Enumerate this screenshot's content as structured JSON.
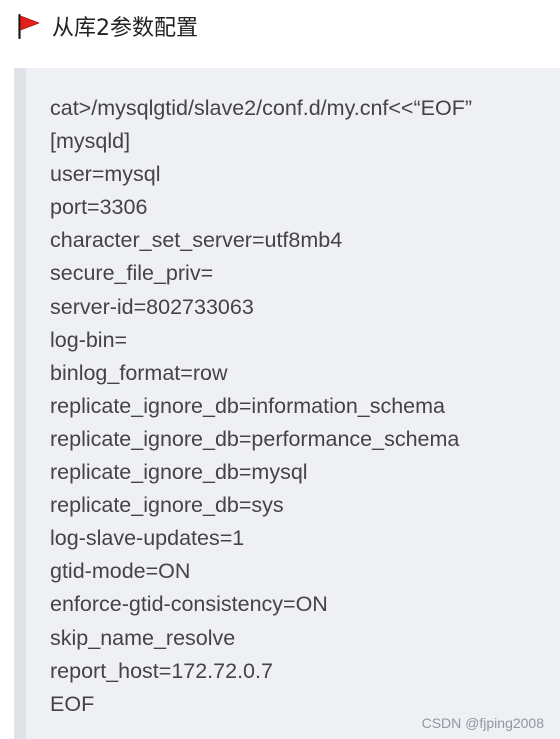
{
  "heading": {
    "icon": "red-flag-icon",
    "title": "从库2参数配置"
  },
  "code_block": {
    "lines": [
      "cat>/mysqlgtid/slave2/conf.d/my.cnf<<“EOF”",
      "[mysqld]",
      "user=mysql",
      "port=3306",
      "character_set_server=utf8mb4",
      "secure_file_priv=",
      "server-id=802733063",
      "log-bin=",
      "binlog_format=row",
      "replicate_ignore_db=information_schema",
      "replicate_ignore_db=performance_schema",
      "replicate_ignore_db=mysql",
      "replicate_ignore_db=sys",
      "log-slave-updates=1",
      "gtid-mode=ON",
      "enforce-gtid-consistency=ON",
      "skip_name_resolve",
      "report_host=172.72.0.7",
      "EOF"
    ]
  },
  "watermark": "CSDN @fjping2008",
  "colors": {
    "flag": "#e0201c",
    "block_background": "#eef0f4",
    "block_border": "#dfe2e7"
  }
}
